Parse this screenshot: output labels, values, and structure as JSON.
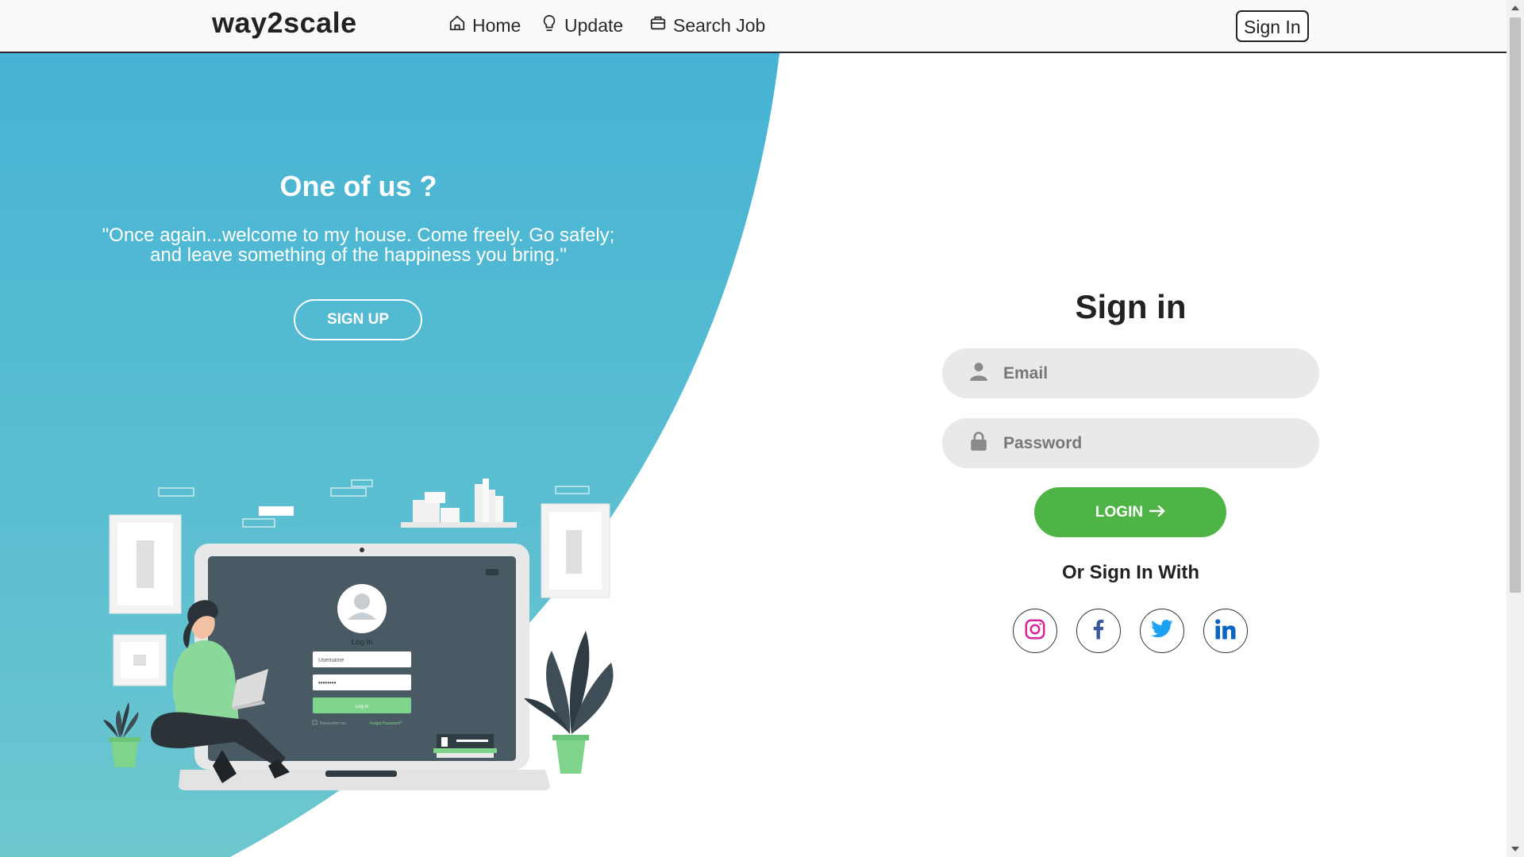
{
  "nav": {
    "brand": "way2scale",
    "links": [
      {
        "label": "Home",
        "icon": "home-icon"
      },
      {
        "label": "Update",
        "icon": "lightbulb-icon"
      },
      {
        "label": "Search Job",
        "icon": "briefcase-icon"
      }
    ],
    "signin_label": "Sign In"
  },
  "hero": {
    "title": "One of us ?",
    "quote": "\"Once again...welcome to my house. Come freely. Go safely; and leave something of the happiness you bring.\"",
    "signup_label": "SIGN UP",
    "illustration": {
      "login_title": "Log In",
      "username_placeholder": "Username",
      "password_mask": "••••••••",
      "login_button": "Log in",
      "remember_me": "Remember me",
      "forgot_password": "Forgot Password?"
    }
  },
  "signin": {
    "title": "Sign in",
    "email_placeholder": "Email",
    "password_placeholder": "Password",
    "login_label": "LOGIN",
    "or_text": "Or Sign In With",
    "social": [
      "instagram-icon",
      "facebook-icon",
      "twitter-icon",
      "linkedin-icon"
    ]
  },
  "colors": {
    "hero_gradient_top": "#46b3d4",
    "hero_gradient_bottom": "#6cc7cf",
    "login_green": "#4fb446",
    "field_bg": "#e9e9e9",
    "instagram": "#d6249f",
    "facebook": "#3b5998",
    "twitter": "#1da1f2",
    "linkedin": "#0a66c2"
  }
}
